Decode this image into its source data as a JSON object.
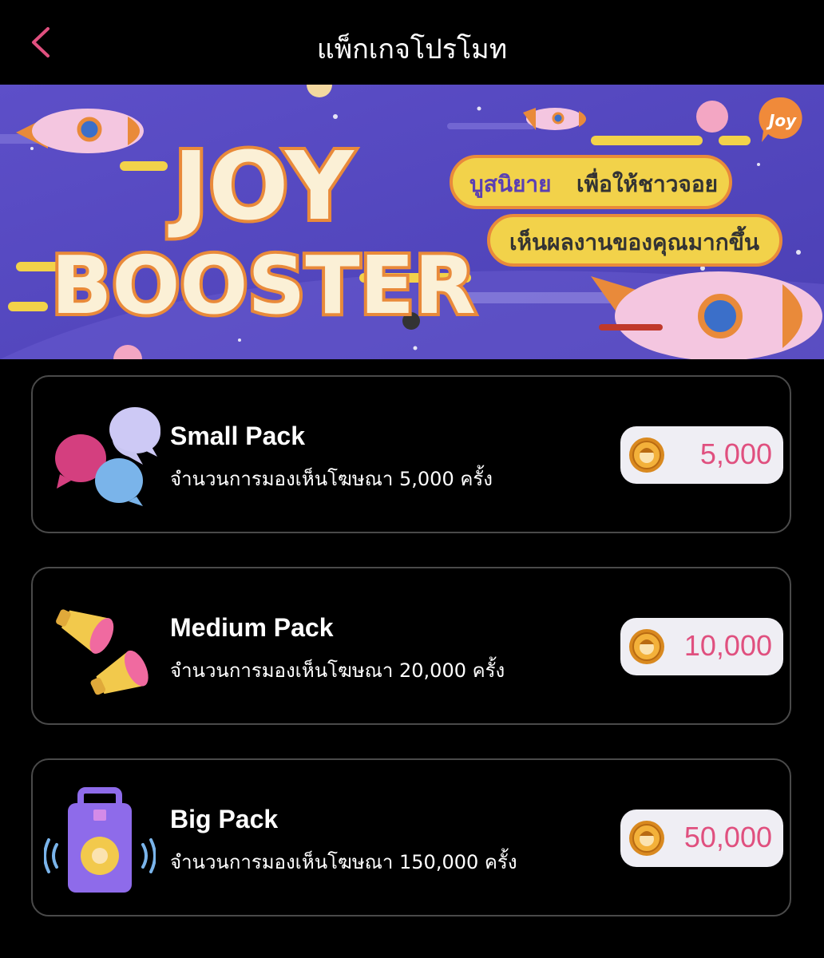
{
  "header": {
    "title": "แพ็กเกจโปรโมท",
    "back_icon": "chevron-left-icon"
  },
  "banner": {
    "headline_line1": "JOY",
    "headline_line2": "BOOSTER",
    "tagline_line1_highlight": "บูสนิยาย",
    "tagline_line1_rest": "เพื่อให้ชาวจอย",
    "tagline_line2": "เห็นผลงานของคุณมากขึ้น",
    "logo": "Joy"
  },
  "packs": [
    {
      "name": "Small Pack",
      "description": "จำนวนการมองเห็นโฆษณา 5,000 ครั้ง",
      "price": "5,000",
      "icon": "speech-bubbles-icon"
    },
    {
      "name": "Medium Pack",
      "description": "จำนวนการมองเห็นโฆษณา 20,000 ครั้ง",
      "price": "10,000",
      "icon": "megaphones-icon"
    },
    {
      "name": "Big Pack",
      "description": "จำนวนการมองเห็นโฆษณา 150,000 ครั้ง",
      "price": "50,000",
      "icon": "speaker-icon"
    }
  ],
  "colors": {
    "accent": "#e0507f",
    "background": "#000000",
    "card_border": "#4a4a4a",
    "price_pill": "#efeef4",
    "banner_bg": "#5a4cc2",
    "banner_yellow": "#f2d24a",
    "banner_orange": "#e98a3a"
  }
}
